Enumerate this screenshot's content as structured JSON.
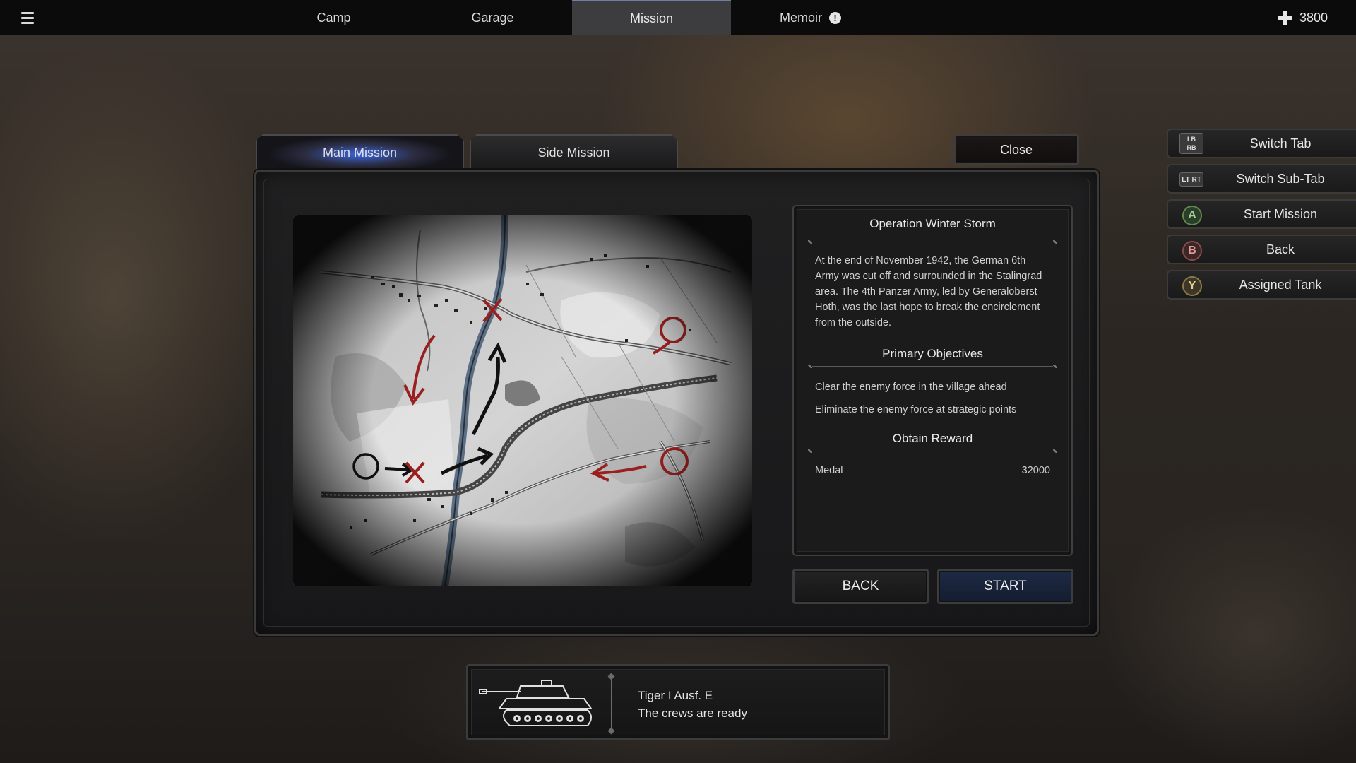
{
  "topbar": {
    "tabs": [
      {
        "label": "Camp",
        "active": false
      },
      {
        "label": "Garage",
        "active": false
      },
      {
        "label": "Mission",
        "active": true
      },
      {
        "label": "Memoir",
        "active": false,
        "alert_icon": "exclamation-icon"
      }
    ],
    "currency": {
      "icon": "iron-cross-icon",
      "value": "3800"
    }
  },
  "mission_tabs": {
    "main": "Main Mission",
    "side": "Side Mission",
    "close": "Close"
  },
  "mission": {
    "title": "Operation Winter Storm",
    "description": "At the end of November 1942, the German 6th Army was cut off and surrounded in the Stalingrad area. The 4th Panzer Army, led by Generaloberst Hoth, was the last hope to break the encirclement from the outside.",
    "objectives_heading": "Primary Objectives",
    "objectives": [
      "Clear the enemy force in the village ahead",
      "Eliminate the enemy force at strategic points"
    ],
    "reward_heading": "Obtain Reward",
    "reward": {
      "label": "Medal",
      "value": "32000"
    }
  },
  "actions": {
    "back": "BACK",
    "start": "START"
  },
  "controls": [
    {
      "glyph": "LB RB",
      "label": "Switch Tab"
    },
    {
      "glyph": "LT RT",
      "label": "Switch Sub-Tab"
    },
    {
      "glyph": "A",
      "label": "Start Mission"
    },
    {
      "glyph": "B",
      "label": "Back"
    },
    {
      "glyph": "Y",
      "label": "Assigned Tank"
    }
  ],
  "tank": {
    "icon": "tiger-tank-icon",
    "name": "Tiger I Ausf. E",
    "status": "The crews are ready"
  },
  "colors": {
    "accent_blue": "#3c6eff",
    "map_red": "#9a2020",
    "panel_bg": "#1b1b1c"
  }
}
